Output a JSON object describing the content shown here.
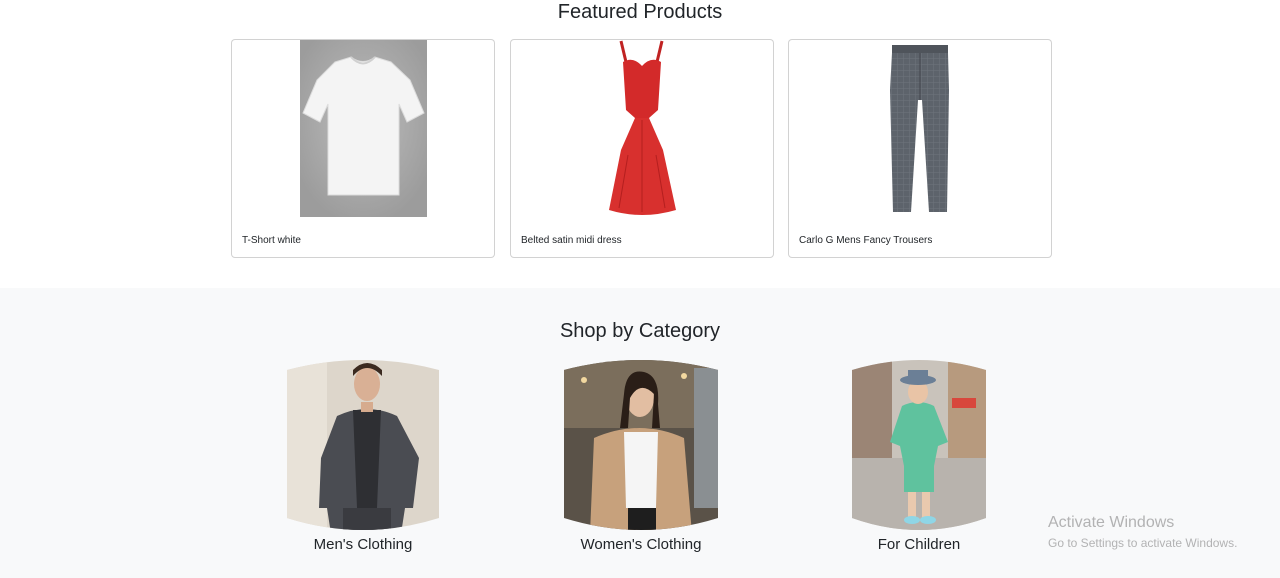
{
  "featured": {
    "title": "Featured Products",
    "products": [
      {
        "name": "T-Short white",
        "image": "white-tshirt"
      },
      {
        "name": "Belted satin midi dress",
        "image": "red-dress"
      },
      {
        "name": "Carlo G Mens Fancy Trousers",
        "image": "grey-trousers"
      }
    ]
  },
  "category": {
    "title": "Shop by Category",
    "items": [
      {
        "label": "Men's Clothing",
        "image": "man-in-blazer"
      },
      {
        "label": "Women's Clothing",
        "image": "woman-in-beige-coat"
      },
      {
        "label": "For Children",
        "image": "boy-in-green-suit"
      }
    ]
  },
  "watermark": {
    "title": "Activate Windows",
    "subtitle": "Go to Settings to activate Windows."
  },
  "colors": {
    "category_bg": "#f8f9fa",
    "dress": "#d32a2a",
    "trousers": "#5a5f66"
  }
}
